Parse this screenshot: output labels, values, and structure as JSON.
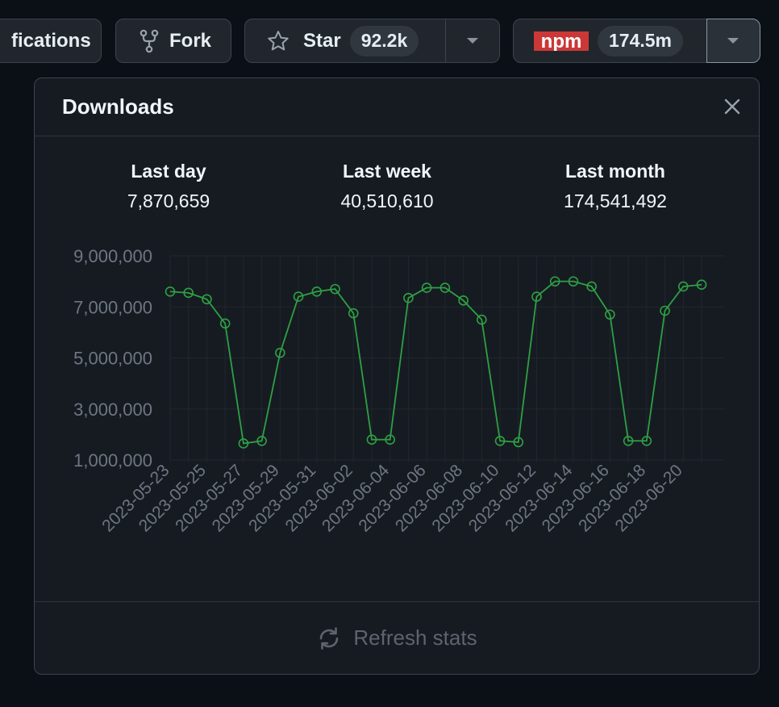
{
  "toolbar": {
    "notifications_label": "fications",
    "fork_label": "Fork",
    "star_label": "Star",
    "star_count": "92.2k",
    "npm_logo_text": "npm",
    "npm_count": "174.5m"
  },
  "popover": {
    "title": "Downloads",
    "stats": [
      {
        "label": "Last day",
        "value": "7,870,659"
      },
      {
        "label": "Last week",
        "value": "40,510,610"
      },
      {
        "label": "Last month",
        "value": "174,541,492"
      }
    ],
    "refresh_label": "Refresh stats"
  },
  "colors": {
    "line": "#2ea043",
    "grid": "#21262d",
    "tick": "#6e7681",
    "npm_red": "#cb3837"
  },
  "chart_data": {
    "type": "line",
    "title": "",
    "xlabel": "",
    "ylabel": "",
    "ylim": [
      1000000,
      9000000
    ],
    "yticks": [
      {
        "value": 9000000,
        "label": "9,000,000"
      },
      {
        "value": 7000000,
        "label": "7,000,000"
      },
      {
        "value": 5000000,
        "label": "5,000,000"
      },
      {
        "value": 3000000,
        "label": "3,000,000"
      },
      {
        "value": 1000000,
        "label": "1,000,000"
      }
    ],
    "x_tick_labels": [
      "2023-05-23",
      "2023-05-25",
      "2023-05-27",
      "2023-05-29",
      "2023-05-31",
      "2023-06-02",
      "2023-06-04",
      "2023-06-06",
      "2023-06-08",
      "2023-06-10",
      "2023-06-12",
      "2023-06-14",
      "2023-06-16",
      "2023-06-18",
      "2023-06-20"
    ],
    "grid": true,
    "series": [
      {
        "x": [
          "2023-05-23",
          "2023-05-24",
          "2023-05-25",
          "2023-05-26",
          "2023-05-27",
          "2023-05-28",
          "2023-05-29",
          "2023-05-30",
          "2023-05-31",
          "2023-06-01",
          "2023-06-02",
          "2023-06-03",
          "2023-06-04",
          "2023-06-05",
          "2023-06-06",
          "2023-06-07",
          "2023-06-08",
          "2023-06-09",
          "2023-06-10",
          "2023-06-11",
          "2023-06-12",
          "2023-06-13",
          "2023-06-14",
          "2023-06-15",
          "2023-06-16",
          "2023-06-17",
          "2023-06-18",
          "2023-06-19",
          "2023-06-20",
          "2023-06-21"
        ],
        "values": [
          7600000,
          7550000,
          7300000,
          6350000,
          1650000,
          1750000,
          5200000,
          7400000,
          7600000,
          7700000,
          6750000,
          1800000,
          1800000,
          7350000,
          7750000,
          7750000,
          7250000,
          6500000,
          1750000,
          1700000,
          7400000,
          8000000,
          8000000,
          7800000,
          6700000,
          1750000,
          1750000,
          6850000,
          7800000,
          7870659
        ]
      }
    ]
  }
}
